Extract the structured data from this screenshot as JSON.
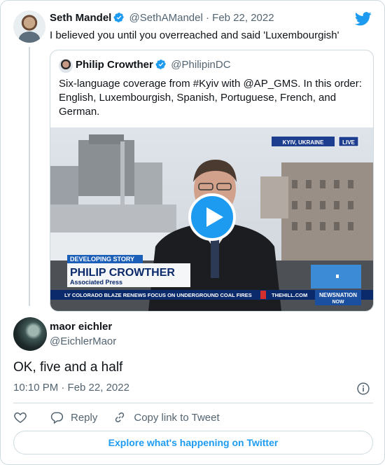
{
  "colors": {
    "accent": "#1d9bf0",
    "text": "#0f1419",
    "muted": "#536471",
    "border": "#cfd9de"
  },
  "parent_tweet": {
    "author_name": "Seth Mandel",
    "handle": "@SethAMandel",
    "date": "· Feb 22, 2022",
    "text": "I believed you until you overreached and said 'Luxembourgish'"
  },
  "quoted_tweet": {
    "author_name": "Philip Crowther",
    "handle": "@PhilipinDC",
    "text": "Six-language coverage from #Kyiv with @AP_GMS. In this order: English, Luxembourgish, Spanish, Portuguese, French, and German.",
    "video": {
      "location_tag": "KYIV, UKRAINE",
      "live_tag": "LIVE",
      "lower_third_kicker": "DEVELOPING STORY",
      "lower_third_name": "PHILIP CROWTHER",
      "lower_third_org": "Associated Press",
      "ticker": "LY COLORADO BLAZE RENEWS FOCUS ON UNDERGROUND COAL FIRES",
      "ticker_source": "THEHILL.COM",
      "network_logo_top": "NEWSNATION",
      "network_logo_bottom": "NOW"
    }
  },
  "reply_tweet": {
    "author_name": "maor eichler",
    "handle": "@EichlerMaor",
    "text": "OK, five and a half",
    "timestamp": "10:10 PM · Feb 22, 2022"
  },
  "actions": {
    "reply_label": "Reply",
    "copy_link_label": "Copy link to Tweet"
  },
  "explore_label": "Explore what's happening on Twitter",
  "icons": [
    "twitter-bird-icon",
    "verified-badge-icon",
    "play-icon",
    "info-icon",
    "heart-icon",
    "reply-icon",
    "link-icon"
  ]
}
